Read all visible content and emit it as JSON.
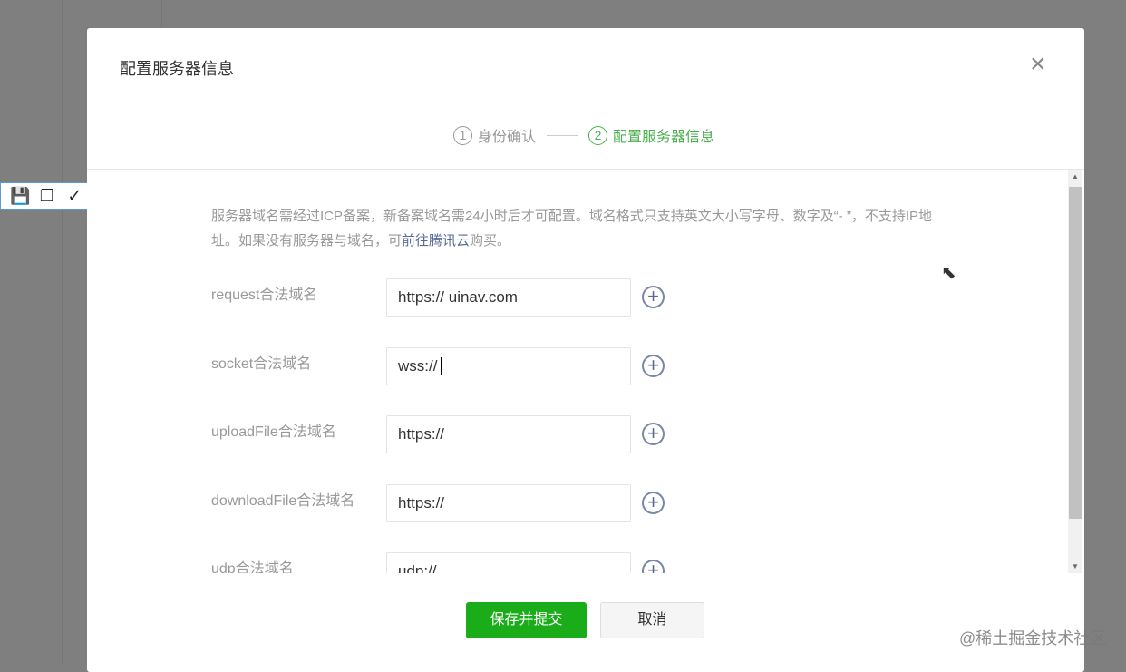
{
  "toolbar": {
    "icons": [
      "save-icon",
      "copy-icon",
      "check-icon"
    ]
  },
  "modal": {
    "title": "配置服务器信息",
    "close_icon": "×",
    "steps": [
      {
        "num": "1",
        "label": "身份确认"
      },
      {
        "num": "2",
        "label": "配置服务器信息"
      }
    ],
    "description": {
      "text1": "服务器域名需经过ICP备案，新备案域名需24小时后才可配置。域名格式只支持英文大小写字母、数字及“- ”，不支持IP地址。如果没有服务器与域名，可",
      "link": "前往腾讯云",
      "text2": "购买。"
    },
    "rows": [
      {
        "label": "request合法域名",
        "value": "https:// uinav.com"
      },
      {
        "label": "socket合法域名",
        "value": "wss://"
      },
      {
        "label": "uploadFile合法域名",
        "value": "https://"
      },
      {
        "label": "downloadFile合法域名",
        "value": "https://"
      },
      {
        "label": "udp合法域名",
        "value": "udp://"
      }
    ],
    "save_label": "保存并提交",
    "cancel_label": "取消"
  },
  "watermark": "@稀土掘金技术社区",
  "colors": {
    "accent": "#1aad19",
    "step_active": "#4caf50",
    "link": "#576b95"
  }
}
